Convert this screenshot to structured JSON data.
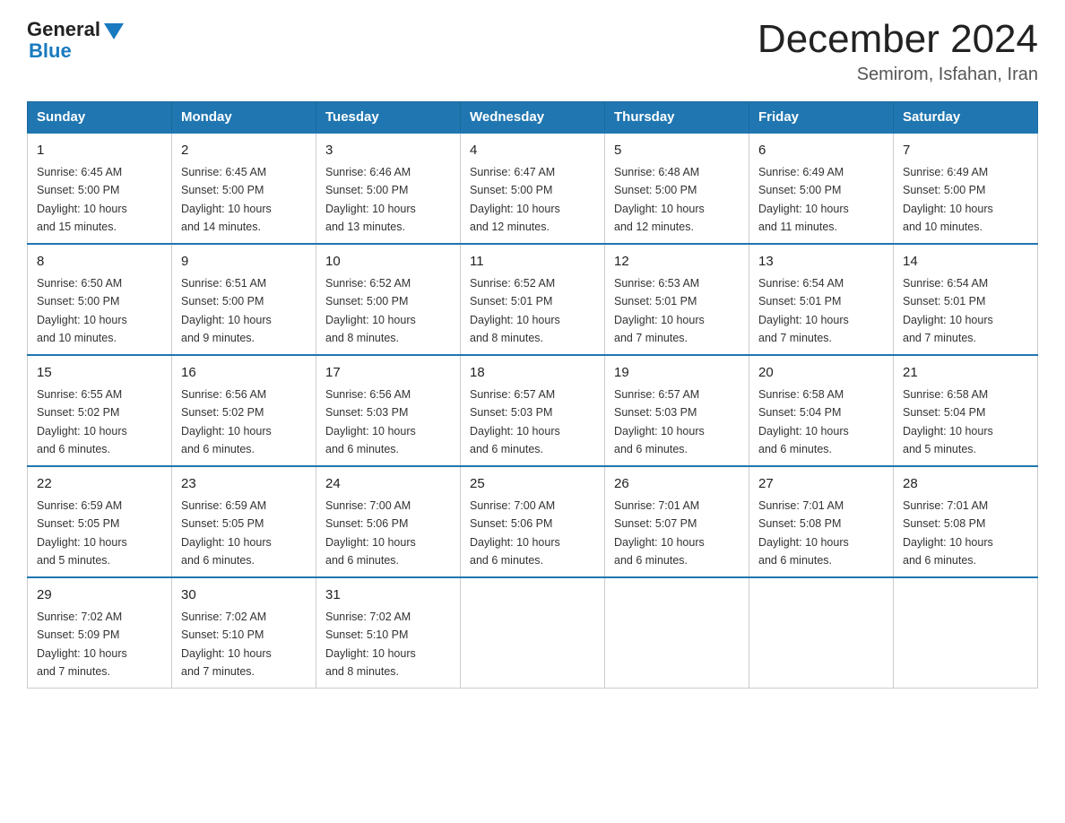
{
  "header": {
    "logo_general": "General",
    "logo_blue": "Blue",
    "title": "December 2024",
    "subtitle": "Semirom, Isfahan, Iran"
  },
  "columns": [
    "Sunday",
    "Monday",
    "Tuesday",
    "Wednesday",
    "Thursday",
    "Friday",
    "Saturday"
  ],
  "weeks": [
    [
      {
        "day": "1",
        "sunrise": "6:45 AM",
        "sunset": "5:00 PM",
        "daylight": "10 hours and 15 minutes."
      },
      {
        "day": "2",
        "sunrise": "6:45 AM",
        "sunset": "5:00 PM",
        "daylight": "10 hours and 14 minutes."
      },
      {
        "day": "3",
        "sunrise": "6:46 AM",
        "sunset": "5:00 PM",
        "daylight": "10 hours and 13 minutes."
      },
      {
        "day": "4",
        "sunrise": "6:47 AM",
        "sunset": "5:00 PM",
        "daylight": "10 hours and 12 minutes."
      },
      {
        "day": "5",
        "sunrise": "6:48 AM",
        "sunset": "5:00 PM",
        "daylight": "10 hours and 12 minutes."
      },
      {
        "day": "6",
        "sunrise": "6:49 AM",
        "sunset": "5:00 PM",
        "daylight": "10 hours and 11 minutes."
      },
      {
        "day": "7",
        "sunrise": "6:49 AM",
        "sunset": "5:00 PM",
        "daylight": "10 hours and 10 minutes."
      }
    ],
    [
      {
        "day": "8",
        "sunrise": "6:50 AM",
        "sunset": "5:00 PM",
        "daylight": "10 hours and 10 minutes."
      },
      {
        "day": "9",
        "sunrise": "6:51 AM",
        "sunset": "5:00 PM",
        "daylight": "10 hours and 9 minutes."
      },
      {
        "day": "10",
        "sunrise": "6:52 AM",
        "sunset": "5:00 PM",
        "daylight": "10 hours and 8 minutes."
      },
      {
        "day": "11",
        "sunrise": "6:52 AM",
        "sunset": "5:01 PM",
        "daylight": "10 hours and 8 minutes."
      },
      {
        "day": "12",
        "sunrise": "6:53 AM",
        "sunset": "5:01 PM",
        "daylight": "10 hours and 7 minutes."
      },
      {
        "day": "13",
        "sunrise": "6:54 AM",
        "sunset": "5:01 PM",
        "daylight": "10 hours and 7 minutes."
      },
      {
        "day": "14",
        "sunrise": "6:54 AM",
        "sunset": "5:01 PM",
        "daylight": "10 hours and 7 minutes."
      }
    ],
    [
      {
        "day": "15",
        "sunrise": "6:55 AM",
        "sunset": "5:02 PM",
        "daylight": "10 hours and 6 minutes."
      },
      {
        "day": "16",
        "sunrise": "6:56 AM",
        "sunset": "5:02 PM",
        "daylight": "10 hours and 6 minutes."
      },
      {
        "day": "17",
        "sunrise": "6:56 AM",
        "sunset": "5:03 PM",
        "daylight": "10 hours and 6 minutes."
      },
      {
        "day": "18",
        "sunrise": "6:57 AM",
        "sunset": "5:03 PM",
        "daylight": "10 hours and 6 minutes."
      },
      {
        "day": "19",
        "sunrise": "6:57 AM",
        "sunset": "5:03 PM",
        "daylight": "10 hours and 6 minutes."
      },
      {
        "day": "20",
        "sunrise": "6:58 AM",
        "sunset": "5:04 PM",
        "daylight": "10 hours and 6 minutes."
      },
      {
        "day": "21",
        "sunrise": "6:58 AM",
        "sunset": "5:04 PM",
        "daylight": "10 hours and 5 minutes."
      }
    ],
    [
      {
        "day": "22",
        "sunrise": "6:59 AM",
        "sunset": "5:05 PM",
        "daylight": "10 hours and 5 minutes."
      },
      {
        "day": "23",
        "sunrise": "6:59 AM",
        "sunset": "5:05 PM",
        "daylight": "10 hours and 6 minutes."
      },
      {
        "day": "24",
        "sunrise": "7:00 AM",
        "sunset": "5:06 PM",
        "daylight": "10 hours and 6 minutes."
      },
      {
        "day": "25",
        "sunrise": "7:00 AM",
        "sunset": "5:06 PM",
        "daylight": "10 hours and 6 minutes."
      },
      {
        "day": "26",
        "sunrise": "7:01 AM",
        "sunset": "5:07 PM",
        "daylight": "10 hours and 6 minutes."
      },
      {
        "day": "27",
        "sunrise": "7:01 AM",
        "sunset": "5:08 PM",
        "daylight": "10 hours and 6 minutes."
      },
      {
        "day": "28",
        "sunrise": "7:01 AM",
        "sunset": "5:08 PM",
        "daylight": "10 hours and 6 minutes."
      }
    ],
    [
      {
        "day": "29",
        "sunrise": "7:02 AM",
        "sunset": "5:09 PM",
        "daylight": "10 hours and 7 minutes."
      },
      {
        "day": "30",
        "sunrise": "7:02 AM",
        "sunset": "5:10 PM",
        "daylight": "10 hours and 7 minutes."
      },
      {
        "day": "31",
        "sunrise": "7:02 AM",
        "sunset": "5:10 PM",
        "daylight": "10 hours and 8 minutes."
      },
      null,
      null,
      null,
      null
    ]
  ],
  "labels": {
    "sunrise": "Sunrise:",
    "sunset": "Sunset:",
    "daylight": "Daylight:"
  }
}
